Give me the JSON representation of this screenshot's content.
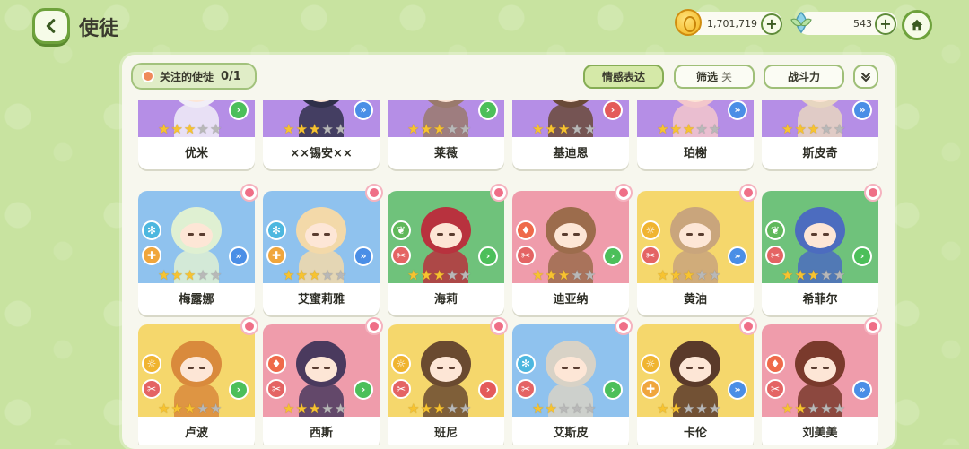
{
  "header": {
    "title": "使徒",
    "coins": "1,701,719",
    "gems": "543",
    "plus": "+"
  },
  "toolbar": {
    "follow_label": "关注的使徒",
    "follow_count": "0/1",
    "emote_label": "情感表达",
    "filter_label": "筛选",
    "filter_state": "关",
    "power_label": "战斗力"
  },
  "colors": {
    "purple": "#b58ee6",
    "blue": "#8fc2ee",
    "green": "#6fc27b",
    "pink": "#ef9cab",
    "yellow": "#f5d76c"
  },
  "rows": [
    {
      "cards": [
        {
          "name": "优米",
          "bg": "purple",
          "stars": 3,
          "hair": "#f1eef7",
          "role": "heal-cross",
          "type": "",
          "arrow": "green"
        },
        {
          "name": "××锡安××",
          "bg": "purple",
          "stars": 3,
          "hair": "#30304a",
          "role": "attack-swords",
          "type": "",
          "arrow": "blue"
        },
        {
          "name": "莱薇",
          "bg": "purple",
          "stars": 3,
          "hair": "#9a7a6c",
          "role": "attack-swords",
          "type": "",
          "arrow": "green"
        },
        {
          "name": "基迪恩",
          "bg": "purple",
          "stars": 3,
          "hair": "#6a4a38",
          "role": "attack-swords",
          "type": "",
          "arrow": "red"
        },
        {
          "name": "珀榭",
          "bg": "purple",
          "stars": 3,
          "hair": "#f3c7cb",
          "role": "heal-cross",
          "type": "",
          "arrow": "blue"
        },
        {
          "name": "斯皮奇",
          "bg": "purple",
          "stars": 3,
          "hair": "#e7d6c0",
          "role": "attack-swords",
          "type": "",
          "arrow": "blue"
        }
      ]
    },
    {
      "cards": [
        {
          "name": "梅露娜",
          "bg": "blue",
          "stars": 3,
          "hair": "#dff0d2",
          "role": "water-flake",
          "type": "heal-cross",
          "arrow": "blue"
        },
        {
          "name": "艾蜜莉雅",
          "bg": "blue",
          "stars": 3,
          "hair": "#f3d9a9",
          "role": "water-flake",
          "type": "heal-cross",
          "arrow": "blue"
        },
        {
          "name": "海莉",
          "bg": "green",
          "stars": 3,
          "hair": "#b8323e",
          "role": "wind-leaf",
          "type": "attack-swords",
          "arrow": "green"
        },
        {
          "name": "迪亚纳",
          "bg": "pink",
          "stars": 3,
          "hair": "#9c6c4c",
          "role": "fire-drop",
          "type": "attack-swords",
          "arrow": "green"
        },
        {
          "name": "黄油",
          "bg": "yellow",
          "stars": 3,
          "hair": "#c9a57c",
          "role": "light-sun",
          "type": "attack-swords",
          "arrow": "blue"
        },
        {
          "name": "希菲尔",
          "bg": "green",
          "stars": 3,
          "hair": "#4c6cbf",
          "role": "wind-leaf",
          "type": "attack-swords",
          "arrow": "green"
        }
      ]
    },
    {
      "cards": [
        {
          "name": "卢波",
          "bg": "yellow",
          "stars": 3,
          "hair": "#d98a3c",
          "role": "light-sun",
          "type": "attack-swords",
          "arrow": "green"
        },
        {
          "name": "西斯",
          "bg": "pink",
          "stars": 3,
          "hair": "#4a3a5e",
          "role": "fire-drop",
          "type": "attack-swords",
          "arrow": "green"
        },
        {
          "name": "班尼",
          "bg": "yellow",
          "stars": 3,
          "hair": "#6a4a30",
          "role": "light-sun",
          "type": "attack-swords",
          "arrow": "red"
        },
        {
          "name": "艾斯皮",
          "bg": "blue",
          "stars": 2,
          "hair": "#d8d2c6",
          "role": "water-flake",
          "type": "attack-swords",
          "arrow": "green"
        },
        {
          "name": "卡伦",
          "bg": "yellow",
          "stars": 2,
          "hair": "#5a3a2a",
          "role": "light-sun",
          "type": "heal-cross",
          "arrow": "blue"
        },
        {
          "name": "刘美美",
          "bg": "pink",
          "stars": 2,
          "hair": "#7a3a2c",
          "role": "fire-drop",
          "type": "attack-swords",
          "arrow": "blue"
        }
      ]
    }
  ]
}
